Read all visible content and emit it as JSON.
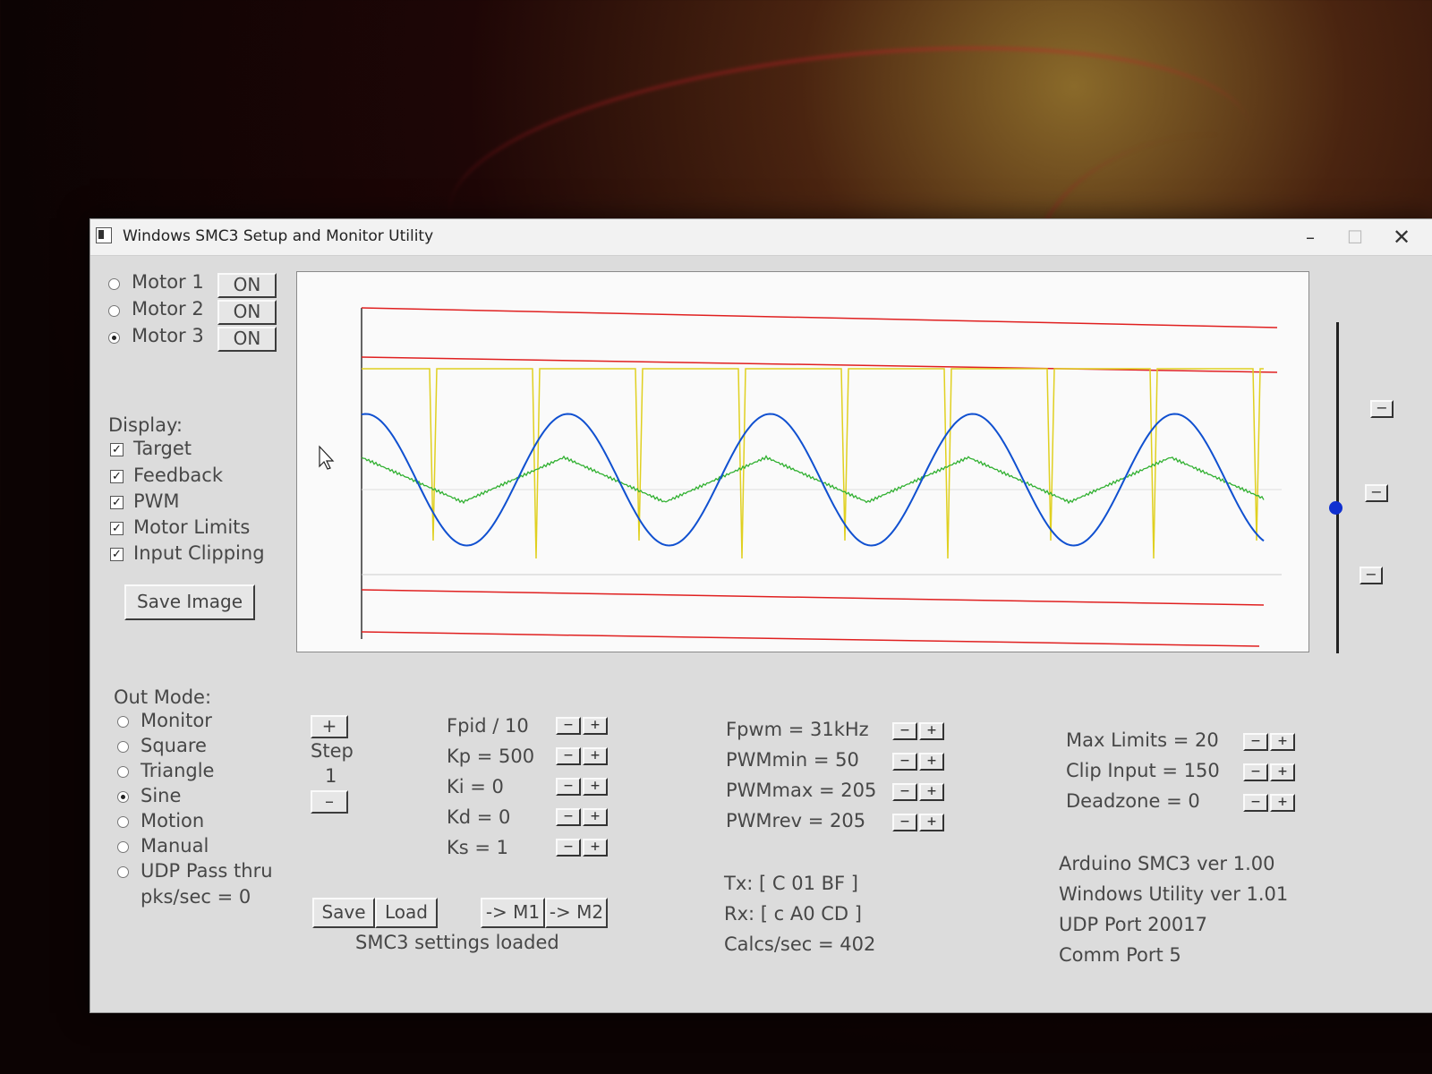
{
  "window": {
    "title": "Windows SMC3 Setup and Monitor Utility",
    "minimize": "–",
    "maximize": "☐",
    "close": "✕"
  },
  "motors": [
    {
      "label": "Motor 1",
      "button": "ON",
      "selected": false
    },
    {
      "label": "Motor 2",
      "button": "ON",
      "selected": false
    },
    {
      "label": "Motor 3",
      "button": "ON",
      "selected": true
    }
  ],
  "display": {
    "heading": "Display:",
    "options": [
      {
        "label": "Target",
        "checked": true
      },
      {
        "label": "Feedback",
        "checked": true
      },
      {
        "label": "PWM",
        "checked": true
      },
      {
        "label": "Motor Limits",
        "checked": true
      },
      {
        "label": "Input Clipping",
        "checked": true
      }
    ],
    "save_image": "Save Image"
  },
  "out_mode": {
    "heading": "Out Mode:",
    "options": [
      {
        "label": "Monitor",
        "selected": false
      },
      {
        "label": "Square",
        "selected": false
      },
      {
        "label": "Triangle",
        "selected": false
      },
      {
        "label": "Sine",
        "selected": true
      },
      {
        "label": "Motion",
        "selected": false
      },
      {
        "label": "Manual",
        "selected": false
      },
      {
        "label": "UDP Pass thru",
        "selected": false
      }
    ],
    "pkts": "pks/sec = 0"
  },
  "step": {
    "plus": "+",
    "label": "Step",
    "value": "1",
    "minus": "–"
  },
  "pid": [
    "Fpid / 10",
    "Kp = 500",
    "Ki = 0",
    "Kd = 0",
    "Ks = 1"
  ],
  "pwm": [
    "Fpwm = 31kHz",
    "PWMmin = 50",
    "PWMmax = 205",
    "PWMrev = 205"
  ],
  "limits": [
    "Max Limits = 20",
    "Clip Input = 150",
    "Deadzone = 0"
  ],
  "buttons": {
    "save": "Save",
    "load": "Load",
    "m1": "-> M1",
    "m2": "-> M2"
  },
  "status": "SMC3 settings loaded",
  "comm": {
    "tx": "Tx: [ C 01 BF ]",
    "rx": "Rx: [ c A0 CD ]",
    "calcs": "Calcs/sec = 402"
  },
  "info": [
    "Arduino SMC3 ver 1.00",
    "Windows Utility ver 1.01",
    "UDP Port 20017",
    "Comm Port 5"
  ],
  "colors": {
    "limit": "#e02020",
    "pwm": "#e0d020",
    "target": "#30b030",
    "feedback": "#1050d0"
  }
}
